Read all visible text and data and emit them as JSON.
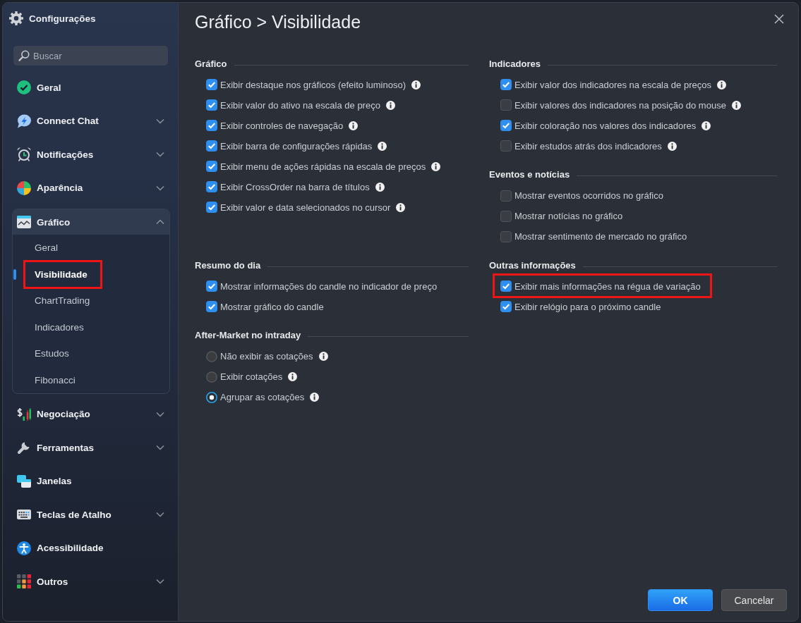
{
  "window": {
    "title": "Configurações"
  },
  "sidebar": {
    "search": {
      "placeholder": "Buscar"
    },
    "items": [
      {
        "label": "Geral"
      },
      {
        "label": "Connect Chat",
        "expanded": false
      },
      {
        "label": "Notificações",
        "expanded": false
      },
      {
        "label": "Aparência",
        "expanded": false
      },
      {
        "label": "Gráfico",
        "expanded": true,
        "children": [
          {
            "label": "Geral",
            "selected": false
          },
          {
            "label": "Visibilidade",
            "selected": true,
            "highlighted": true
          },
          {
            "label": "ChartTrading",
            "selected": false
          },
          {
            "label": "Indicadores",
            "selected": false
          },
          {
            "label": "Estudos",
            "selected": false
          },
          {
            "label": "Fibonacci",
            "selected": false
          }
        ]
      },
      {
        "label": "Negociação",
        "expanded": false
      },
      {
        "label": "Ferramentas",
        "expanded": false
      },
      {
        "label": "Janelas"
      },
      {
        "label": "Teclas de Atalho",
        "expanded": false
      },
      {
        "label": "Acessibilidade"
      },
      {
        "label": "Outros",
        "expanded": false
      }
    ]
  },
  "page": {
    "title": "Gráfico > Visibilidade"
  },
  "rows": [
    {
      "cells": [
        {
          "sections": [
            {
              "title": "Gráfico",
              "options": [
                {
                  "kind": "checkbox",
                  "label": "Exibir destaque nos gráficos (efeito luminoso)",
                  "checked": true,
                  "info": true
                },
                {
                  "kind": "checkbox",
                  "label": "Exibir valor do ativo na escala de preço",
                  "checked": true,
                  "info": true
                },
                {
                  "kind": "checkbox",
                  "label": "Exibir controles de navegação",
                  "checked": true,
                  "info": true
                },
                {
                  "kind": "checkbox",
                  "label": "Exibir barra de configurações rápidas",
                  "checked": true,
                  "info": true
                },
                {
                  "kind": "checkbox",
                  "label": "Exibir menu de ações rápidas na escala de preços",
                  "checked": true,
                  "info": true
                },
                {
                  "kind": "checkbox",
                  "label": "Exibir CrossOrder na barra de títulos",
                  "checked": true,
                  "info": true
                },
                {
                  "kind": "checkbox",
                  "label": "Exibir valor e data selecionados no cursor",
                  "checked": true,
                  "info": true
                }
              ]
            }
          ]
        },
        {
          "sections": [
            {
              "title": "Indicadores",
              "options": [
                {
                  "kind": "checkbox",
                  "label": "Exibir valor dos indicadores na escala de preços",
                  "checked": true,
                  "info": true
                },
                {
                  "kind": "checkbox",
                  "label": "Exibir valores dos indicadores na posição do mouse",
                  "checked": false,
                  "info": true
                },
                {
                  "kind": "checkbox",
                  "label": "Exibir coloração nos valores dos indicadores",
                  "checked": true,
                  "info": true
                },
                {
                  "kind": "checkbox",
                  "label": "Exibir estudos atrás dos indicadores",
                  "checked": false,
                  "info": true
                }
              ]
            },
            {
              "title": "Eventos e notícias",
              "options": [
                {
                  "kind": "checkbox",
                  "label": "Mostrar eventos ocorridos no gráfico",
                  "checked": false
                },
                {
                  "kind": "checkbox",
                  "label": "Mostrar notícias no gráfico",
                  "checked": false
                },
                {
                  "kind": "checkbox",
                  "label": "Mostrar sentimento de mercado no gráfico",
                  "checked": false
                }
              ]
            }
          ]
        }
      ]
    },
    {
      "cells": [
        {
          "sections": [
            {
              "title": "Resumo do dia",
              "options": [
                {
                  "kind": "checkbox",
                  "label": "Mostrar informações do candle no indicador de preço",
                  "checked": true
                },
                {
                  "kind": "checkbox",
                  "label": "Mostrar gráfico do candle",
                  "checked": true
                }
              ]
            },
            {
              "title": "After-Market no intraday",
              "options": [
                {
                  "kind": "radio",
                  "label": "Não exibir as cotações",
                  "selected": false,
                  "info": true
                },
                {
                  "kind": "radio",
                  "label": "Exibir cotações",
                  "selected": false,
                  "info": true
                },
                {
                  "kind": "radio",
                  "label": "Agrupar as cotações",
                  "selected": true,
                  "info": true
                }
              ]
            }
          ]
        },
        {
          "sections": [
            {
              "title": "Outras informações",
              "options": [
                {
                  "kind": "checkbox",
                  "label": "Exibir mais informações na régua de variação",
                  "checked": true,
                  "highlighted": true
                },
                {
                  "kind": "checkbox",
                  "label": "Exibir relógio para o próximo candle",
                  "checked": true
                }
              ]
            }
          ]
        }
      ]
    }
  ],
  "buttons": [
    {
      "label": "OK",
      "kind": "primary"
    },
    {
      "label": "Cancelar",
      "kind": "secondary"
    }
  ]
}
